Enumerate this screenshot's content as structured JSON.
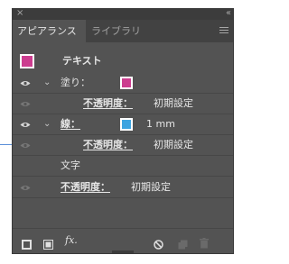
{
  "colors": {
    "pink": "#cc3d8f",
    "blue": "#3ea4e0"
  },
  "titlebar": {
    "close_glyph": "×",
    "collapse_glyph": "‹‹"
  },
  "tabs": [
    {
      "label": "アピアランス",
      "active": true
    },
    {
      "label": "ライブラリ",
      "active": false
    }
  ],
  "rows": {
    "header": {
      "label": "テキスト"
    },
    "fill": {
      "label": "塗り："
    },
    "fill_opacity": {
      "label": "不透明度：",
      "value": "初期設定"
    },
    "stroke": {
      "label": "線：",
      "value": "1 mm"
    },
    "stroke_opacity": {
      "label": "不透明度：",
      "value": "初期設定"
    },
    "characters": {
      "label": "文字"
    },
    "opacity": {
      "label": "不透明度：",
      "value": "初期設定"
    }
  },
  "bottom": {
    "fx_label": "fx."
  }
}
